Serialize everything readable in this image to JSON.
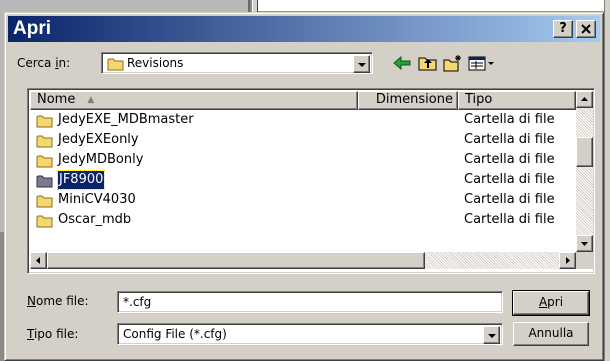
{
  "dialog": {
    "title": "Apri",
    "help_button": "?",
    "close_button": "x"
  },
  "look_in": {
    "label_pre": "Cerca ",
    "label_accel": "i",
    "label_post": "n:",
    "value": "Revisions"
  },
  "toolbar": {
    "icons": [
      "back-arrow-icon",
      "up-folder-icon",
      "new-folder-icon",
      "view-menu-icon"
    ]
  },
  "file_list": {
    "columns": {
      "name": "Nome",
      "size": "Dimensione",
      "type": "Tipo"
    },
    "rows": [
      {
        "name": "JedyEXE_MDBmaster",
        "size": "",
        "type": "Cartella di file"
      },
      {
        "name": "JedyEXEonly",
        "size": "",
        "type": "Cartella di file"
      },
      {
        "name": "JedyMDBonly",
        "size": "",
        "type": "Cartella di file"
      },
      {
        "name": "JF8900",
        "size": "",
        "type": "Cartella di file",
        "selected": true
      },
      {
        "name": "MiniCV4030",
        "size": "",
        "type": "Cartella di file"
      },
      {
        "name": "Oscar_mdb",
        "size": "",
        "type": "Cartella di file"
      }
    ]
  },
  "file_name": {
    "label_accel": "N",
    "label_rest": "ome file:",
    "value": "*.cfg"
  },
  "file_type": {
    "label_accel": "T",
    "label_rest": "ipo file:",
    "value": "Config File (*.cfg)"
  },
  "buttons": {
    "open_accel": "A",
    "open_rest": "pri",
    "cancel": "Annulla"
  },
  "colors": {
    "title_gradient_start": "#0a246a",
    "title_gradient_end": "#a6caf0",
    "face": "#d4d0c8",
    "selection": "#0a246a",
    "folder": "#f5d76e"
  }
}
